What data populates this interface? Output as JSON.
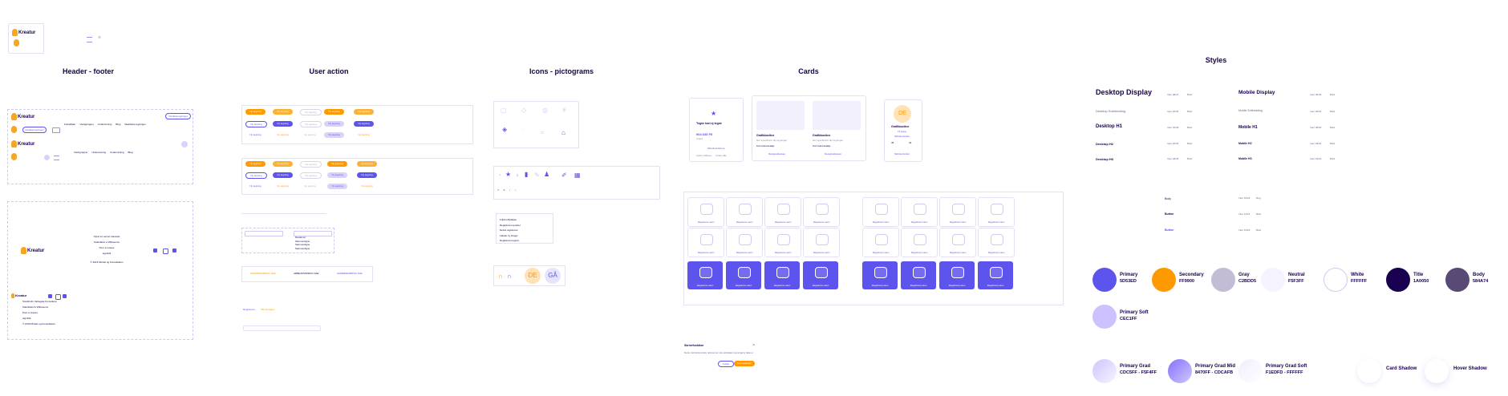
{
  "brand": {
    "name": "Kreatur"
  },
  "sections": {
    "header_footer": "Header - footer",
    "user_action": "User action",
    "icons": "Icons - pictograms",
    "cards": "Cards",
    "styles": "Styles"
  },
  "header": {
    "nav": [
      "Fotoaftaler",
      "Værkgrupper",
      "Undervisning",
      "Blog",
      "Meddelse tegninger"
    ],
    "nav_right_button": "Værktøj tegninger",
    "signup_button": "Værktøj tegninger",
    "nav2": [
      "Værkgrupper",
      "Undervisning",
      "Undervisning",
      "Blog"
    ]
  },
  "footer": {
    "links": [
      "Opret en server Hacedet",
      "Kaleriklets e Vlilbesems",
      "Poor a reques",
      "tegnfolk"
    ],
    "copyright": "© 2019 Mindst og Konsultation",
    "links2": [
      "Stockholm Varlegate Konsultere",
      "Kaleriklets & Vlilbesems",
      "Poor a reques",
      "tegnfolk"
    ],
    "copyright2": "© 2019 Mindst og Konsultation"
  },
  "buttons": {
    "primary": "Ny tegning",
    "disabled": "Ny tegning"
  },
  "inputs": {
    "dropdown_options": [
      "Dansk tal",
      "Sammenligne",
      "Sammenligne",
      "Sammenligne",
      "Sammenligne"
    ],
    "tabs": [
      "SAMMENFØRING SAE",
      "ARBEJDSSPROG SAE",
      "SAMMENFØRING SAE"
    ],
    "toggle_left": "Registreret",
    "toggle_right": "Slet kortagen"
  },
  "legend_items": [
    "Fuldt udfyldelse",
    "Registreret oprettet",
    "Delvis registreret",
    "Indsæt ny bruger",
    "Registreret tegnet"
  ],
  "avatars": {
    "a1": "DE",
    "a2": "GÅ"
  },
  "cards": {
    "card1": {
      "title": "Tegne kort ej tegne",
      "value": "904 638 F5",
      "sub": "Linker",
      "link": "Skriv/kombinere",
      "meta": [
        "Anden Måned",
        "Linker Alle"
      ]
    },
    "card2": {
      "title": "Grafikkonline",
      "body": "Her specificere din tegninger",
      "meta": "Kort tekst detalje",
      "link": "Designeklassen"
    },
    "card3": {
      "title": "Grafikkonline",
      "body": "Her specificere din tegninger",
      "meta": "Kort tekst detalje",
      "link": "Designeklassen"
    },
    "card4": {
      "avatar": "DE",
      "name": "Grafikkonline",
      "sub": "Til signe",
      "link": "Skrivkontroller",
      "stats": [
        "45",
        "42"
      ]
    }
  },
  "tiles_label": "Registreret navn",
  "dialog": {
    "title": "Skrivefunktion",
    "body": "Dette rumskrævende referencer via værktøjer tegningeny lade er",
    "cancel": "Lukke",
    "confirm": "Lad tegninger"
  },
  "styles": {
    "typography": [
      {
        "name": "Desktop Display",
        "size": "Inter 48/72",
        "w": "Bold"
      },
      {
        "name": "Desktop Subheading",
        "size": "Inter 26/35",
        "w": "Bold"
      },
      {
        "name": "Desktop H1",
        "size": "Inter 32/48",
        "w": "Bold"
      },
      {
        "name": "Desktop H2",
        "size": "Inter 20/33",
        "w": "Bold"
      },
      {
        "name": "Desktop H3",
        "size": "Inter 18/33",
        "w": "Bold"
      }
    ],
    "typography_mobile": [
      {
        "name": "Mobile Display",
        "size": "Inter 36/45",
        "w": "Bold"
      },
      {
        "name": "Mobile Subheading",
        "size": "Inter 18/32",
        "w": "Bold"
      },
      {
        "name": "Mobile H1",
        "size": "Inter 28/33",
        "w": "Bold"
      },
      {
        "name": "Mobile H2",
        "size": "Inter 18/24",
        "w": "Bold"
      },
      {
        "name": "Mobile H3",
        "size": "Inter 16/24",
        "w": "Bold"
      }
    ],
    "body": [
      {
        "name": "Body",
        "size": "Inter 16/24",
        "w": "Reg"
      },
      {
        "name": "Button",
        "size": "Inter 14/21",
        "w": "Bold"
      },
      {
        "name": "Button",
        "size": "Inter 12/18",
        "w": "Bold"
      }
    ],
    "colors": [
      {
        "name": "Primary",
        "hex": "5D53ED",
        "color": "#5D53ED"
      },
      {
        "name": "Secondary",
        "hex": "FF9900",
        "color": "#FF9900"
      },
      {
        "name": "Gray",
        "hex": "C2BDD5",
        "color": "#C2BDD5"
      },
      {
        "name": "Neutral",
        "hex": "F5F3FF",
        "color": "#F5F3FF"
      },
      {
        "name": "White",
        "hex": "FFFFFF",
        "color": "#FFFFFF"
      },
      {
        "name": "Title",
        "hex": "1A0050",
        "color": "#1A0050"
      },
      {
        "name": "Body",
        "hex": "584A74",
        "color": "#584A74"
      },
      {
        "name": "Primary Soft",
        "hex": "CEC1FF",
        "color": "#CEC1FF"
      }
    ],
    "gradients": [
      {
        "name": "Primary Grad",
        "hex": "CDC5FF - F5F4FF"
      },
      {
        "name": "Primary Grad Mid",
        "hex": "8470FF - CDCAFB"
      },
      {
        "name": "Primary Grad Soft",
        "hex": "F1EDFD - FFFFFF"
      }
    ],
    "shadows": [
      "Card Shadow",
      "Hover Shadow"
    ]
  }
}
